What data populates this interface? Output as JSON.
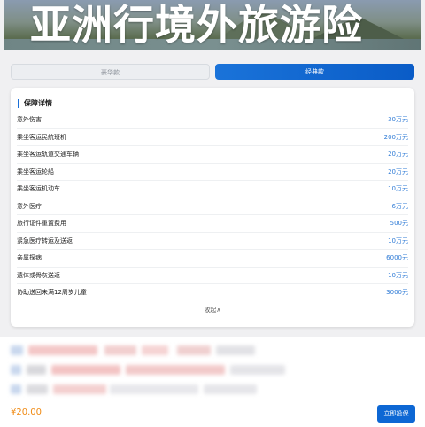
{
  "banner": {
    "title": "亚洲行境外旅游险"
  },
  "tabs": [
    {
      "label": "豪华款",
      "selected": false
    },
    {
      "label": "经典款",
      "selected": true
    }
  ],
  "coverage": {
    "title": "保障详情",
    "items": [
      {
        "name": "意外伤害",
        "amount": "30万元"
      },
      {
        "name": "乘坐客运民航班机",
        "amount": "200万元"
      },
      {
        "name": "乘坐客运轨道交通车辆",
        "amount": "20万元"
      },
      {
        "name": "乘坐客运轮船",
        "amount": "20万元"
      },
      {
        "name": "乘坐客运机动车",
        "amount": "10万元"
      },
      {
        "name": "意外医疗",
        "amount": "6万元"
      },
      {
        "name": "旅行证件重置费用",
        "amount": "500元"
      },
      {
        "name": "紧急医疗转运及送返",
        "amount": "10万元"
      },
      {
        "name": "亲属探病",
        "amount": "6000元"
      },
      {
        "name": "遗体或骨灰送返",
        "amount": "10万元"
      },
      {
        "name": "协助送回未满12周岁儿童",
        "amount": "3000元"
      }
    ],
    "collapse_label": "收起∧"
  },
  "footer": {
    "price": "¥20.00",
    "buy_label": "立即投保"
  },
  "colors": {
    "accent": "#0d67d4",
    "amount": "#2f7bd6",
    "price": "#f08a13"
  }
}
